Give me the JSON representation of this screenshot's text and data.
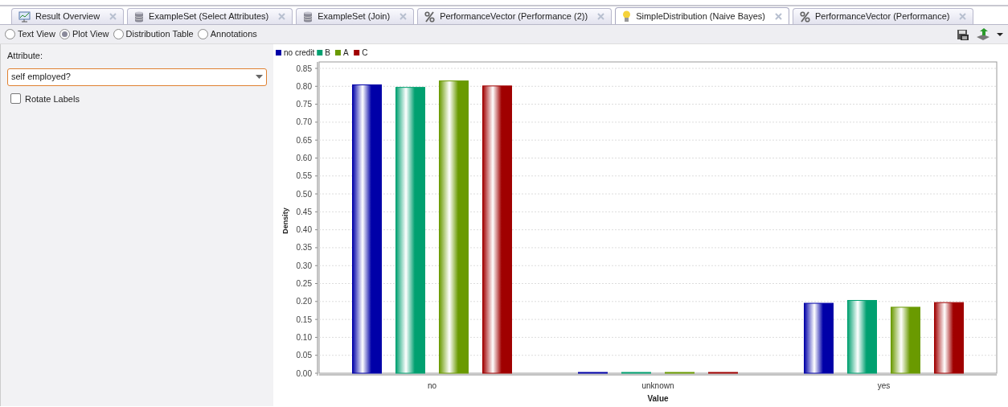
{
  "tabs": [
    {
      "label": "Result Overview",
      "kind": "overview",
      "selected": false
    },
    {
      "label": "ExampleSet (Select Attributes)",
      "kind": "exampleset",
      "selected": false
    },
    {
      "label": "ExampleSet (Join)",
      "kind": "exampleset",
      "selected": false
    },
    {
      "label": "PerformanceVector (Performance (2))",
      "kind": "performance",
      "selected": false
    },
    {
      "label": "SimpleDistribution (Naive Bayes)",
      "kind": "model",
      "selected": true
    },
    {
      "label": "PerformanceVector (Performance)",
      "kind": "performance",
      "selected": false
    }
  ],
  "views": [
    {
      "label": "Text View",
      "selected": false
    },
    {
      "label": "Plot View",
      "selected": true
    },
    {
      "label": "Distribution Table",
      "selected": false
    },
    {
      "label": "Annotations",
      "selected": false
    }
  ],
  "attribute": {
    "label": "Attribute:",
    "value": "self employed?"
  },
  "rotate_labels": {
    "label": "Rotate Labels",
    "checked": false
  },
  "chart_data": {
    "type": "bar",
    "xlabel": "Value",
    "ylabel": "Density",
    "categories": [
      "no",
      "unknown",
      "yes"
    ],
    "series": [
      {
        "name": "no credit",
        "color": "#0000a8",
        "values": [
          0.804,
          0.0,
          0.195
        ]
      },
      {
        "name": "B",
        "color": "#00a070",
        "values": [
          0.797,
          0.0,
          0.203
        ]
      },
      {
        "name": "A",
        "color": "#6a9a00",
        "values": [
          0.815,
          0.0,
          0.184
        ]
      },
      {
        "name": "C",
        "color": "#a00000",
        "values": [
          0.801,
          0.0,
          0.197
        ]
      }
    ],
    "ylim": [
      0,
      0.85
    ],
    "yticks": [
      {
        "value": 0,
        "label": "0.00"
      },
      {
        "value": 0.05,
        "label": "0.05"
      },
      {
        "value": 0.1,
        "label": "0.10"
      },
      {
        "value": 0.15,
        "label": "0.15"
      },
      {
        "value": 0.2,
        "label": "0.20"
      },
      {
        "value": 0.25,
        "label": "0.25"
      },
      {
        "value": 0.3,
        "label": "0.30"
      },
      {
        "value": 0.35,
        "label": "0.35"
      },
      {
        "value": 0.4,
        "label": "0.40"
      },
      {
        "value": 0.45,
        "label": "0.45"
      },
      {
        "value": 0.5,
        "label": "0.50"
      },
      {
        "value": 0.55,
        "label": "0.55"
      },
      {
        "value": 0.6,
        "label": "0.60"
      },
      {
        "value": 0.65,
        "label": "0.65"
      },
      {
        "value": 0.7,
        "label": "0.70"
      },
      {
        "value": 0.75,
        "label": "0.75"
      },
      {
        "value": 0.8,
        "label": "0.80"
      },
      {
        "value": 0.85,
        "label": "0.85"
      }
    ],
    "grid": true,
    "legend": true
  }
}
